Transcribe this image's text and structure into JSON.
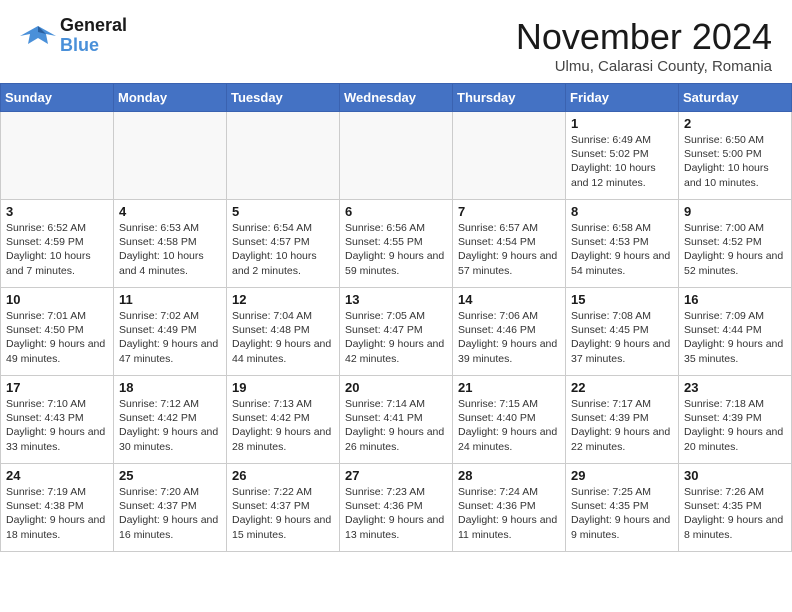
{
  "header": {
    "logo_text_general": "General",
    "logo_text_blue": "Blue",
    "month_title": "November 2024",
    "subtitle": "Ulmu, Calarasi County, Romania"
  },
  "days_of_week": [
    "Sunday",
    "Monday",
    "Tuesday",
    "Wednesday",
    "Thursday",
    "Friday",
    "Saturday"
  ],
  "weeks": [
    [
      {
        "day": "",
        "info": ""
      },
      {
        "day": "",
        "info": ""
      },
      {
        "day": "",
        "info": ""
      },
      {
        "day": "",
        "info": ""
      },
      {
        "day": "",
        "info": ""
      },
      {
        "day": "1",
        "info": "Sunrise: 6:49 AM\nSunset: 5:02 PM\nDaylight: 10 hours and 12 minutes."
      },
      {
        "day": "2",
        "info": "Sunrise: 6:50 AM\nSunset: 5:00 PM\nDaylight: 10 hours and 10 minutes."
      }
    ],
    [
      {
        "day": "3",
        "info": "Sunrise: 6:52 AM\nSunset: 4:59 PM\nDaylight: 10 hours and 7 minutes."
      },
      {
        "day": "4",
        "info": "Sunrise: 6:53 AM\nSunset: 4:58 PM\nDaylight: 10 hours and 4 minutes."
      },
      {
        "day": "5",
        "info": "Sunrise: 6:54 AM\nSunset: 4:57 PM\nDaylight: 10 hours and 2 minutes."
      },
      {
        "day": "6",
        "info": "Sunrise: 6:56 AM\nSunset: 4:55 PM\nDaylight: 9 hours and 59 minutes."
      },
      {
        "day": "7",
        "info": "Sunrise: 6:57 AM\nSunset: 4:54 PM\nDaylight: 9 hours and 57 minutes."
      },
      {
        "day": "8",
        "info": "Sunrise: 6:58 AM\nSunset: 4:53 PM\nDaylight: 9 hours and 54 minutes."
      },
      {
        "day": "9",
        "info": "Sunrise: 7:00 AM\nSunset: 4:52 PM\nDaylight: 9 hours and 52 minutes."
      }
    ],
    [
      {
        "day": "10",
        "info": "Sunrise: 7:01 AM\nSunset: 4:50 PM\nDaylight: 9 hours and 49 minutes."
      },
      {
        "day": "11",
        "info": "Sunrise: 7:02 AM\nSunset: 4:49 PM\nDaylight: 9 hours and 47 minutes."
      },
      {
        "day": "12",
        "info": "Sunrise: 7:04 AM\nSunset: 4:48 PM\nDaylight: 9 hours and 44 minutes."
      },
      {
        "day": "13",
        "info": "Sunrise: 7:05 AM\nSunset: 4:47 PM\nDaylight: 9 hours and 42 minutes."
      },
      {
        "day": "14",
        "info": "Sunrise: 7:06 AM\nSunset: 4:46 PM\nDaylight: 9 hours and 39 minutes."
      },
      {
        "day": "15",
        "info": "Sunrise: 7:08 AM\nSunset: 4:45 PM\nDaylight: 9 hours and 37 minutes."
      },
      {
        "day": "16",
        "info": "Sunrise: 7:09 AM\nSunset: 4:44 PM\nDaylight: 9 hours and 35 minutes."
      }
    ],
    [
      {
        "day": "17",
        "info": "Sunrise: 7:10 AM\nSunset: 4:43 PM\nDaylight: 9 hours and 33 minutes."
      },
      {
        "day": "18",
        "info": "Sunrise: 7:12 AM\nSunset: 4:42 PM\nDaylight: 9 hours and 30 minutes."
      },
      {
        "day": "19",
        "info": "Sunrise: 7:13 AM\nSunset: 4:42 PM\nDaylight: 9 hours and 28 minutes."
      },
      {
        "day": "20",
        "info": "Sunrise: 7:14 AM\nSunset: 4:41 PM\nDaylight: 9 hours and 26 minutes."
      },
      {
        "day": "21",
        "info": "Sunrise: 7:15 AM\nSunset: 4:40 PM\nDaylight: 9 hours and 24 minutes."
      },
      {
        "day": "22",
        "info": "Sunrise: 7:17 AM\nSunset: 4:39 PM\nDaylight: 9 hours and 22 minutes."
      },
      {
        "day": "23",
        "info": "Sunrise: 7:18 AM\nSunset: 4:39 PM\nDaylight: 9 hours and 20 minutes."
      }
    ],
    [
      {
        "day": "24",
        "info": "Sunrise: 7:19 AM\nSunset: 4:38 PM\nDaylight: 9 hours and 18 minutes."
      },
      {
        "day": "25",
        "info": "Sunrise: 7:20 AM\nSunset: 4:37 PM\nDaylight: 9 hours and 16 minutes."
      },
      {
        "day": "26",
        "info": "Sunrise: 7:22 AM\nSunset: 4:37 PM\nDaylight: 9 hours and 15 minutes."
      },
      {
        "day": "27",
        "info": "Sunrise: 7:23 AM\nSunset: 4:36 PM\nDaylight: 9 hours and 13 minutes."
      },
      {
        "day": "28",
        "info": "Sunrise: 7:24 AM\nSunset: 4:36 PM\nDaylight: 9 hours and 11 minutes."
      },
      {
        "day": "29",
        "info": "Sunrise: 7:25 AM\nSunset: 4:35 PM\nDaylight: 9 hours and 9 minutes."
      },
      {
        "day": "30",
        "info": "Sunrise: 7:26 AM\nSunset: 4:35 PM\nDaylight: 9 hours and 8 minutes."
      }
    ]
  ]
}
